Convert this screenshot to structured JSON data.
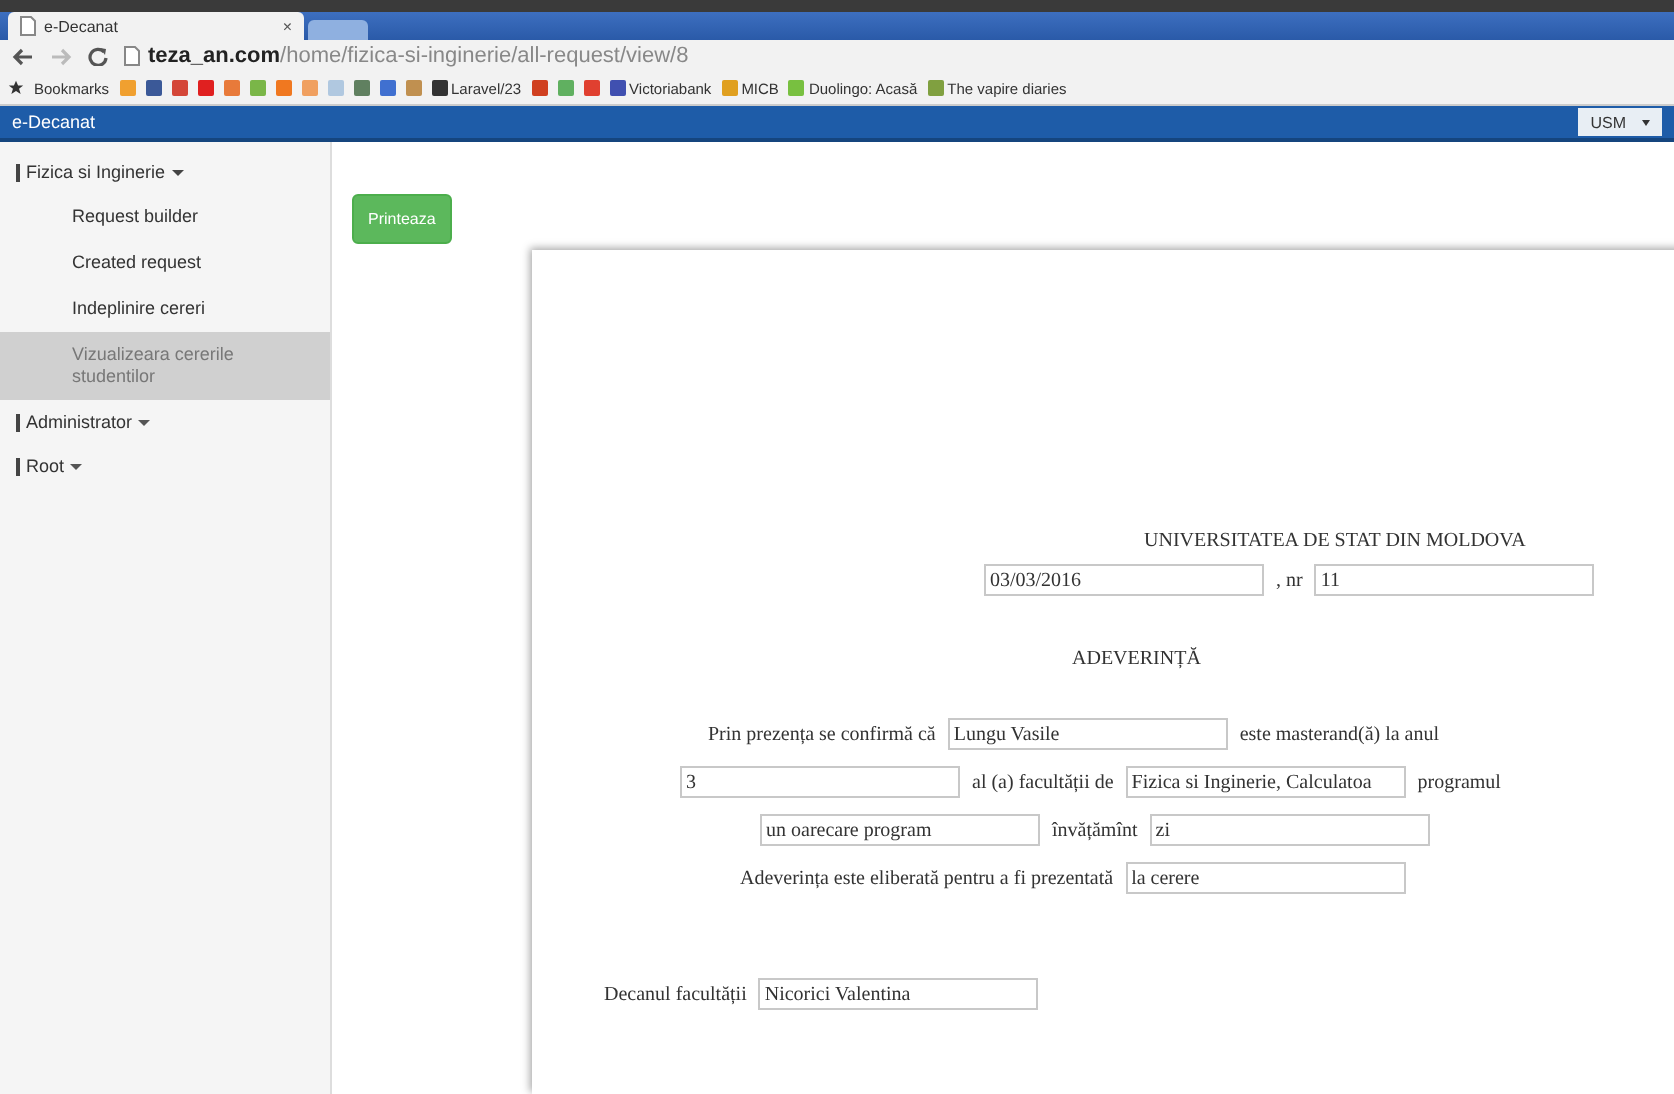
{
  "browser": {
    "tabs": [
      {
        "title": "e-Decanat",
        "close": "×",
        "selected": true
      },
      {
        "selected": false
      }
    ],
    "url_host": "teza_an.com",
    "url_path": "/home/fizica-si-inginerie/all-request/view/8",
    "bookmarks_label": "Bookmarks",
    "bookmarks": [
      {
        "color": "#f0a030"
      },
      {
        "color": "#3b5998"
      },
      {
        "color": "#d44638"
      },
      {
        "color": "#e02020"
      },
      {
        "color": "#e87a3a"
      },
      {
        "color": "#7ab648"
      },
      {
        "color": "#f07820"
      },
      {
        "color": "#f0a060"
      },
      {
        "color": "#b0c8e0"
      },
      {
        "color": "#608060"
      },
      {
        "color": "#4070d0"
      },
      {
        "color": "#c09050"
      },
      {
        "label": "Laravel/23",
        "color": "#333333"
      },
      {
        "color": "#d04020"
      },
      {
        "color": "#60b060"
      },
      {
        "color": "#e04030"
      },
      {
        "label": "Victoriabank",
        "color": "#4050b0"
      },
      {
        "label": "MICB",
        "color": "#e0a020"
      },
      {
        "label": "Duolingo: Acasă",
        "color": "#78c040"
      },
      {
        "label": "The vapire diaries",
        "color": "#80a040"
      }
    ]
  },
  "navbar": {
    "brand": "e-Decanat",
    "dropdown": "USM"
  },
  "sidebar": [
    {
      "label": "Fizica si Inginerie",
      "expanded": true,
      "children": [
        {
          "label": "Request builder",
          "selected": false
        },
        {
          "label": "Created request",
          "selected": false
        },
        {
          "label": "Indeplinire cereri",
          "selected": false
        },
        {
          "label": "Vizualizeara cererile studentilor",
          "selected": true
        }
      ]
    },
    {
      "label": "Administrator",
      "expanded": false
    },
    {
      "label": "Root",
      "expanded": false
    }
  ],
  "print_button": "Printeaza",
  "document": {
    "lines": [
      [
        {
          "kind": "text",
          "text": "UNIVERSITATEA DE STAT DIN MOLDOVA"
        }
      ],
      [
        {
          "kind": "field",
          "value": "03/03/2016"
        },
        {
          "kind": "text",
          "text": ", nr"
        },
        {
          "kind": "field",
          "value": "11"
        }
      ],
      [
        {
          "kind": "title",
          "text": "ADEVERINȚĂ"
        }
      ],
      [
        {
          "kind": "text",
          "text": "Prin prezența se confirmă că"
        },
        {
          "kind": "field",
          "value": "Lungu Vasile"
        },
        {
          "kind": "text",
          "text": "este masterand(ă) la anul"
        }
      ],
      [
        {
          "kind": "field",
          "value": "3"
        },
        {
          "kind": "text",
          "text": "al (a) facultății de"
        },
        {
          "kind": "field",
          "value": "Fizica si Inginerie, Calculatoa"
        },
        {
          "kind": "text",
          "text": "programul"
        }
      ],
      [
        {
          "kind": "field",
          "value": "un oarecare program"
        },
        {
          "kind": "text",
          "text": "învățămînt"
        },
        {
          "kind": "field",
          "value": "zi"
        }
      ],
      [
        {
          "kind": "text",
          "text": "Adeverința este eliberată pentru a fi prezentată"
        },
        {
          "kind": "field",
          "value": "la cerere"
        }
      ],
      [
        {
          "kind": "text",
          "text": "Decanul facultății"
        },
        {
          "kind": "field",
          "value": "Nicorici Valentina"
        }
      ]
    ]
  }
}
